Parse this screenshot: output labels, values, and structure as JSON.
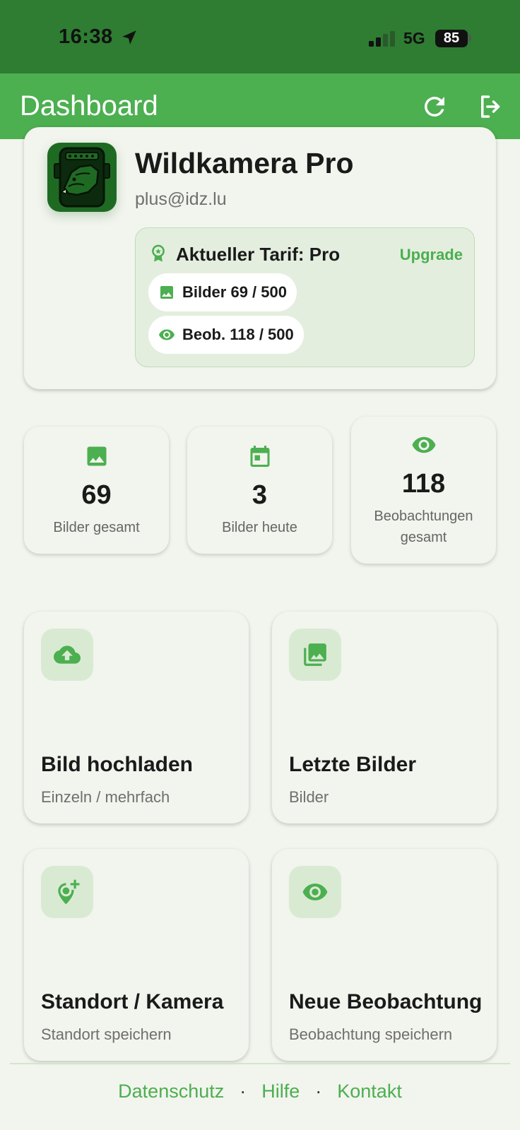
{
  "status_bar": {
    "time": "16:38",
    "network": "5G",
    "battery": "85"
  },
  "app_bar": {
    "title": "Dashboard"
  },
  "profile": {
    "name": "Wildkamera Pro",
    "email": "plus@idz.lu",
    "plan_title": "Aktueller Tarif: Pro",
    "upgrade_label": "Upgrade",
    "images_quota": "Bilder 69 / 500",
    "observations_quota": "Beob. 118 / 500"
  },
  "stats": [
    {
      "value": "69",
      "label": "Bilder gesamt",
      "icon": "image-icon"
    },
    {
      "value": "3",
      "label": "Bilder heute",
      "icon": "calendar-icon"
    },
    {
      "value": "118",
      "label": "Beobachtungen gesamt",
      "icon": "eye-icon"
    }
  ],
  "actions": [
    {
      "title": "Bild hochladen",
      "subtitle": "Einzeln / mehrfach",
      "icon": "cloud-upload-icon"
    },
    {
      "title": "Letzte Bilder",
      "subtitle": "Bilder",
      "icon": "photo-library-icon"
    },
    {
      "title": "Standort / Kamera",
      "subtitle": "Standort speichern",
      "icon": "add-location-icon"
    },
    {
      "title": "Neue Beobachtung",
      "subtitle": "Beobachtung speichern",
      "icon": "eye-icon"
    }
  ],
  "footer": {
    "privacy": "Datenschutz",
    "help": "Hilfe",
    "contact": "Kontakt",
    "separator": "·"
  },
  "colors": {
    "primary": "#4caf50",
    "status_bar": "#2e7d32",
    "background": "#f2f4ee",
    "icon_tint": "#d9ead3"
  }
}
